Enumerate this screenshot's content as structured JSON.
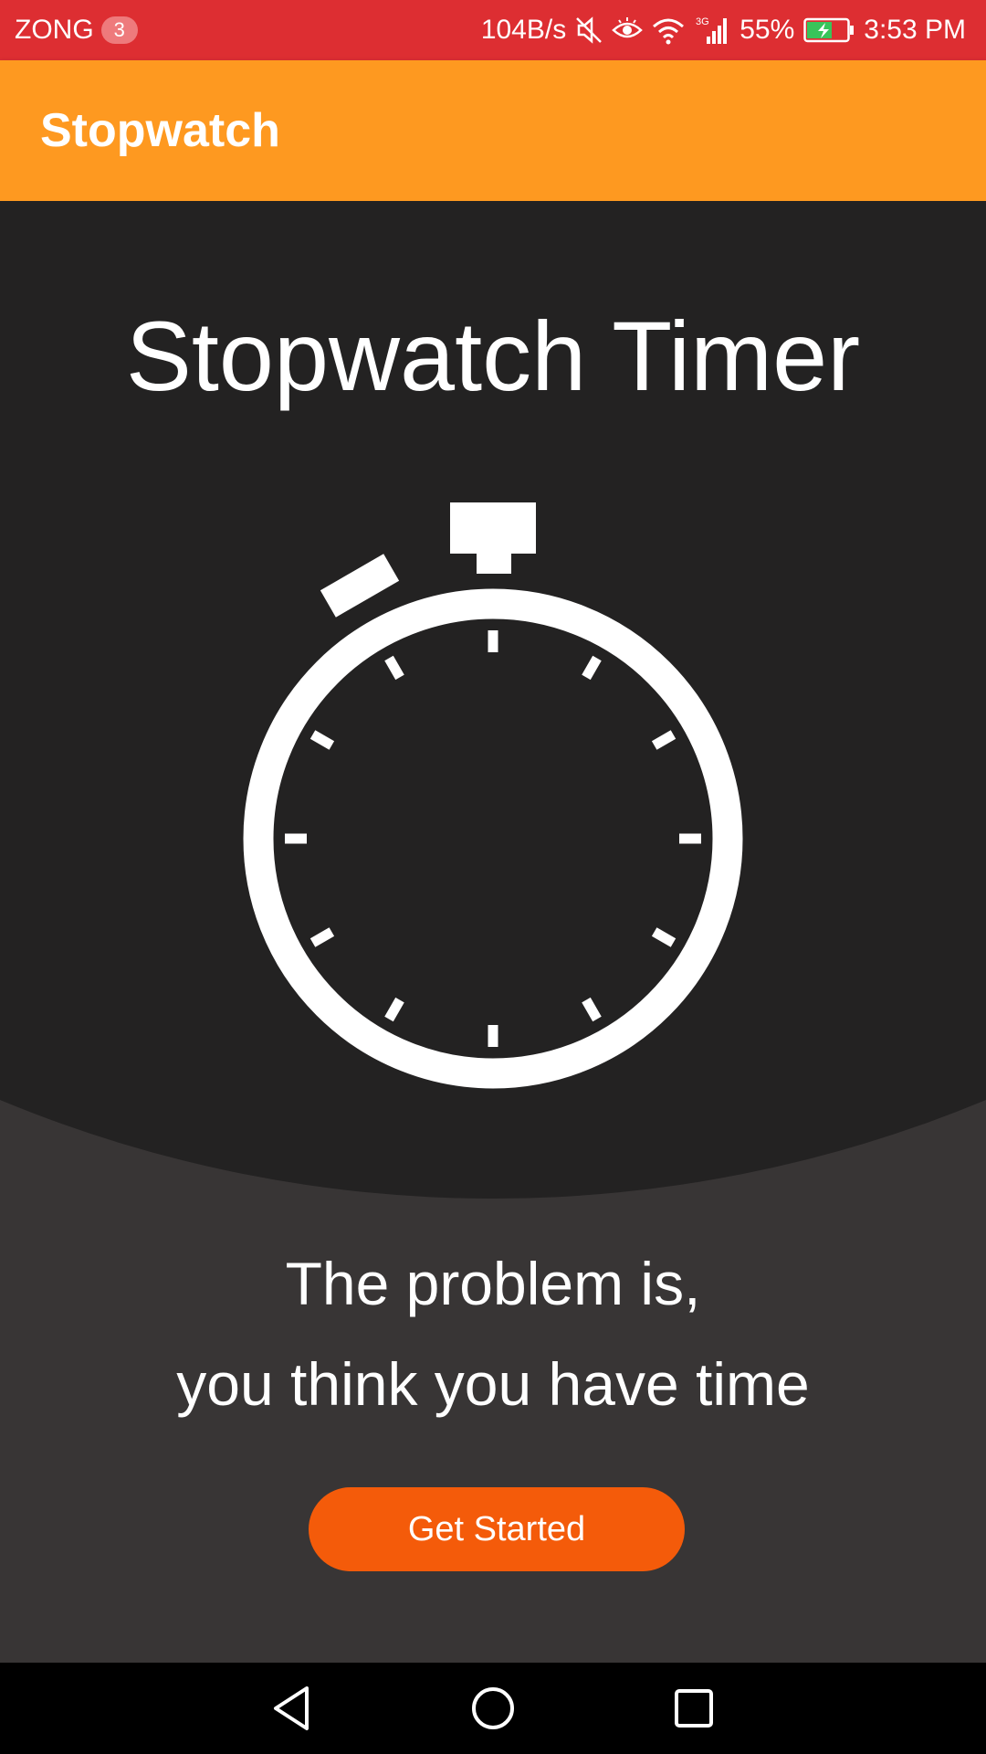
{
  "status_bar": {
    "carrier": "ZONG",
    "sim_badge": "3",
    "net_speed": "104B/s",
    "battery_percent": "55%",
    "time": "3:53 PM",
    "background_color": "#dd2e32",
    "icons": [
      "mute-icon",
      "eye-icon",
      "wifi-icon",
      "signal-icon",
      "battery-charging-icon"
    ]
  },
  "app_bar": {
    "title": "Stopwatch",
    "background_color": "#fe9920"
  },
  "main": {
    "title": "Stopwatch Timer",
    "illustration_icon": "stopwatch-icon",
    "quote_line1": "The problem is,",
    "quote_line2": "you think you have time",
    "cta_label": "Get Started",
    "cta_color": "#f45b0a"
  },
  "nav_bar": {
    "icons": [
      "back-icon",
      "home-icon",
      "recents-icon"
    ]
  }
}
